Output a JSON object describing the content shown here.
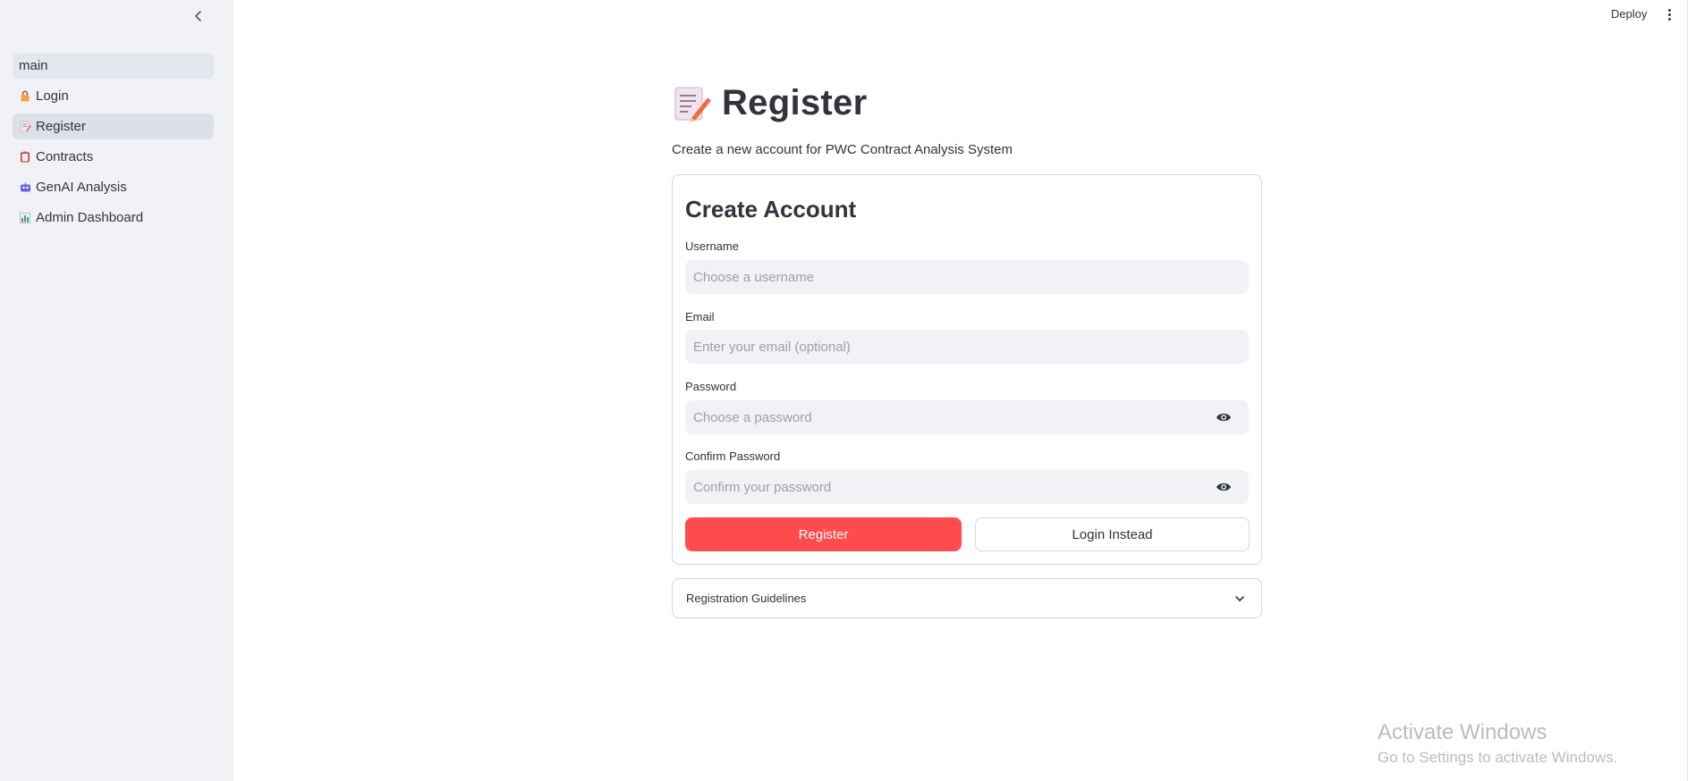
{
  "sidebar": {
    "items": [
      {
        "label": "main",
        "icon": "none"
      },
      {
        "label": "Login",
        "icon": "lock-icon"
      },
      {
        "label": "Register",
        "icon": "memo-icon"
      },
      {
        "label": "Contracts",
        "icon": "clipboard-icon"
      },
      {
        "label": "GenAI Analysis",
        "icon": "robot-icon"
      },
      {
        "label": "Admin Dashboard",
        "icon": "bar-chart-icon"
      }
    ],
    "active": "Register"
  },
  "header": {
    "deploy_label": "Deploy"
  },
  "main": {
    "title": "Register",
    "subtitle": "Create a new account for PWC Contract Analysis System",
    "form": {
      "title": "Create Account",
      "username": {
        "label": "Username",
        "placeholder": "Choose a username",
        "value": ""
      },
      "email": {
        "label": "Email",
        "placeholder": "Enter your email (optional)",
        "value": ""
      },
      "password": {
        "label": "Password",
        "placeholder": "Choose a password",
        "value": ""
      },
      "confirm_password": {
        "label": "Confirm Password",
        "placeholder": "Confirm your password",
        "value": ""
      },
      "register_label": "Register",
      "login_label": "Login Instead"
    },
    "expander_label": "Registration Guidelines"
  },
  "watermark": {
    "title": "Activate Windows",
    "subtitle": "Go to Settings to activate Windows."
  },
  "colors": {
    "primary": "#ff4b4b",
    "sidebar_bg": "#f0f2f6",
    "text": "#31333f",
    "input_bg": "#f0f2f6"
  }
}
